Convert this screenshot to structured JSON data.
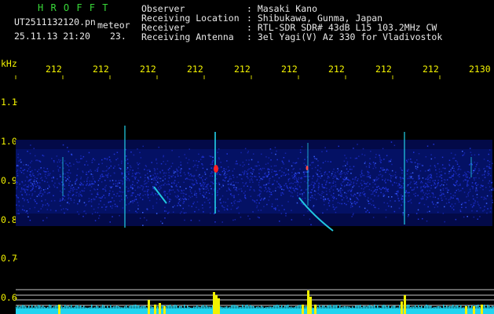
{
  "header": {
    "program": "H R O F F T",
    "filename": "UT2511132120.pn",
    "tag": "meteor",
    "datetime": "25.11.13 21:20",
    "counter": "23.",
    "info": [
      {
        "label": "Observer",
        "value": ": Masaki Kano"
      },
      {
        "label": "Receiving Location",
        "value": ": Shibukawa, Gunma, Japan"
      },
      {
        "label": "Receiver",
        "value": ": RTL-SDR SDR# 43dB L15 103.2MHz CW"
      },
      {
        "label": "Receiving Antenna",
        "value": ": 3el Yagi(V) Az 330 for Vladivostok"
      }
    ]
  },
  "axis": {
    "unit": "kHz",
    "time_labels": [
      "212",
      "212",
      "212",
      "212",
      "212",
      "212",
      "212",
      "212",
      "212",
      "2130"
    ],
    "freq_labels": [
      "1.1",
      "1.0",
      "0.9",
      "0.8",
      "0.7",
      "0.6"
    ]
  },
  "colors": {
    "background": "#000000",
    "noise_band": "#0a1aa0",
    "signal": "#21c8e0",
    "peak": "#ff2020",
    "histogram": "#f2f200",
    "baseline": "#21d4f0"
  }
}
